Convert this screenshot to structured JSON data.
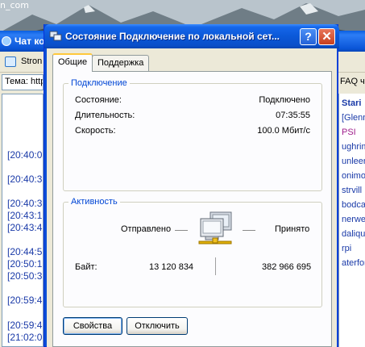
{
  "desktop": {
    "icon_label": "n_com"
  },
  "background_window": {
    "title": "Чат ко",
    "toolbar_text": "Stron",
    "topic_label": "Тема: http",
    "right_tab": "FAQ ч",
    "timestamps": [
      "[20:40:0",
      "[20:40:3",
      "[20:40:3",
      "[20:43:1",
      "[20:43:4",
      "[20:44:5",
      "[20:50:1",
      "[20:50:3",
      "[20:59:4",
      "[20:59:4",
      "[21:02:0"
    ],
    "users": [
      {
        "name": "Stari",
        "color": "#1a3aa8",
        "bold": true
      },
      {
        "name": "[Glenn",
        "color": "#1a3aa8",
        "bold": false
      },
      {
        "name": "PSI",
        "color": "#a0208c",
        "bold": false
      },
      {
        "name": "ughrim",
        "color": "#1a3aa8",
        "bold": false
      },
      {
        "name": "unleer]",
        "color": "#1a3aa8",
        "bold": false
      },
      {
        "name": "onimoy",
        "color": "#1a3aa8",
        "bold": false
      },
      {
        "name": "strvill",
        "color": "#1a3aa8",
        "bold": false
      },
      {
        "name": "bodcat",
        "color": "#1a3aa8",
        "bold": false
      },
      {
        "name": "nerwe",
        "color": "#1a3aa8",
        "bold": false
      },
      {
        "name": "daliqu",
        "color": "#1a3aa8",
        "bold": false
      },
      {
        "name": "rpi",
        "color": "#1a3aa8",
        "bold": false
      },
      {
        "name": "aterfor",
        "color": "#1a3aa8",
        "bold": false
      }
    ]
  },
  "dialog": {
    "title": "Состояние Подключение по локальной сет...",
    "help_glyph": "?",
    "close_glyph": "✕",
    "tabs": [
      {
        "label": "Общие",
        "active": true
      },
      {
        "label": "Поддержка",
        "active": false
      }
    ],
    "connection": {
      "group_title": "Подключение",
      "rows": [
        {
          "label": "Состояние:",
          "value": "Подключено"
        },
        {
          "label": "Длительность:",
          "value": "07:35:55"
        },
        {
          "label": "Скорость:",
          "value": "100.0 Мбит/с"
        }
      ]
    },
    "activity": {
      "group_title": "Активность",
      "sent_label": "Отправлено",
      "received_label": "Принято",
      "bytes_label": "Байт:",
      "bytes_sent": "13 120 834",
      "bytes_received": "382 966 695",
      "icon": "network-computers-icon"
    },
    "buttons": {
      "properties": "Свойства",
      "disable": "Отключить"
    }
  }
}
